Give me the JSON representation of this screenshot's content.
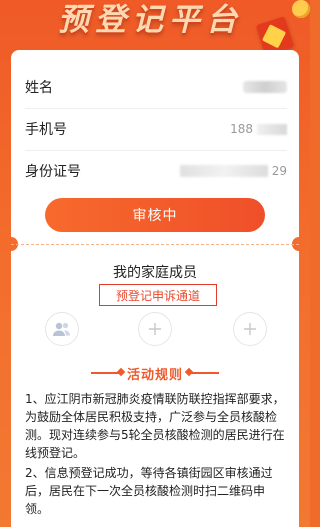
{
  "header": {
    "title": "预登记平台"
  },
  "form": {
    "name_label": "姓名",
    "phone_label": "手机号",
    "phone_prefix": "188",
    "id_label": "身份证号",
    "id_suffix": "29"
  },
  "status": {
    "label": "审核中"
  },
  "family": {
    "title": "我的家庭成员",
    "appeal_label": "预登记申诉通道"
  },
  "rules": {
    "title": "活动规则",
    "items": [
      "1、应江阴市新冠肺炎疫情联防联控指挥部要求，为鼓励全体居民积极支持，广泛参与全员核酸检测。现对连续参与5轮全员核酸检测的居民进行在线预登记。",
      "2、信息预登记成功，等待各镇街园区审核通过后，居民在下一次全员核酸检测时扫二维码申领。"
    ]
  },
  "colors": {
    "accent": "#f06a2a",
    "appeal_border": "#e23b2b"
  }
}
